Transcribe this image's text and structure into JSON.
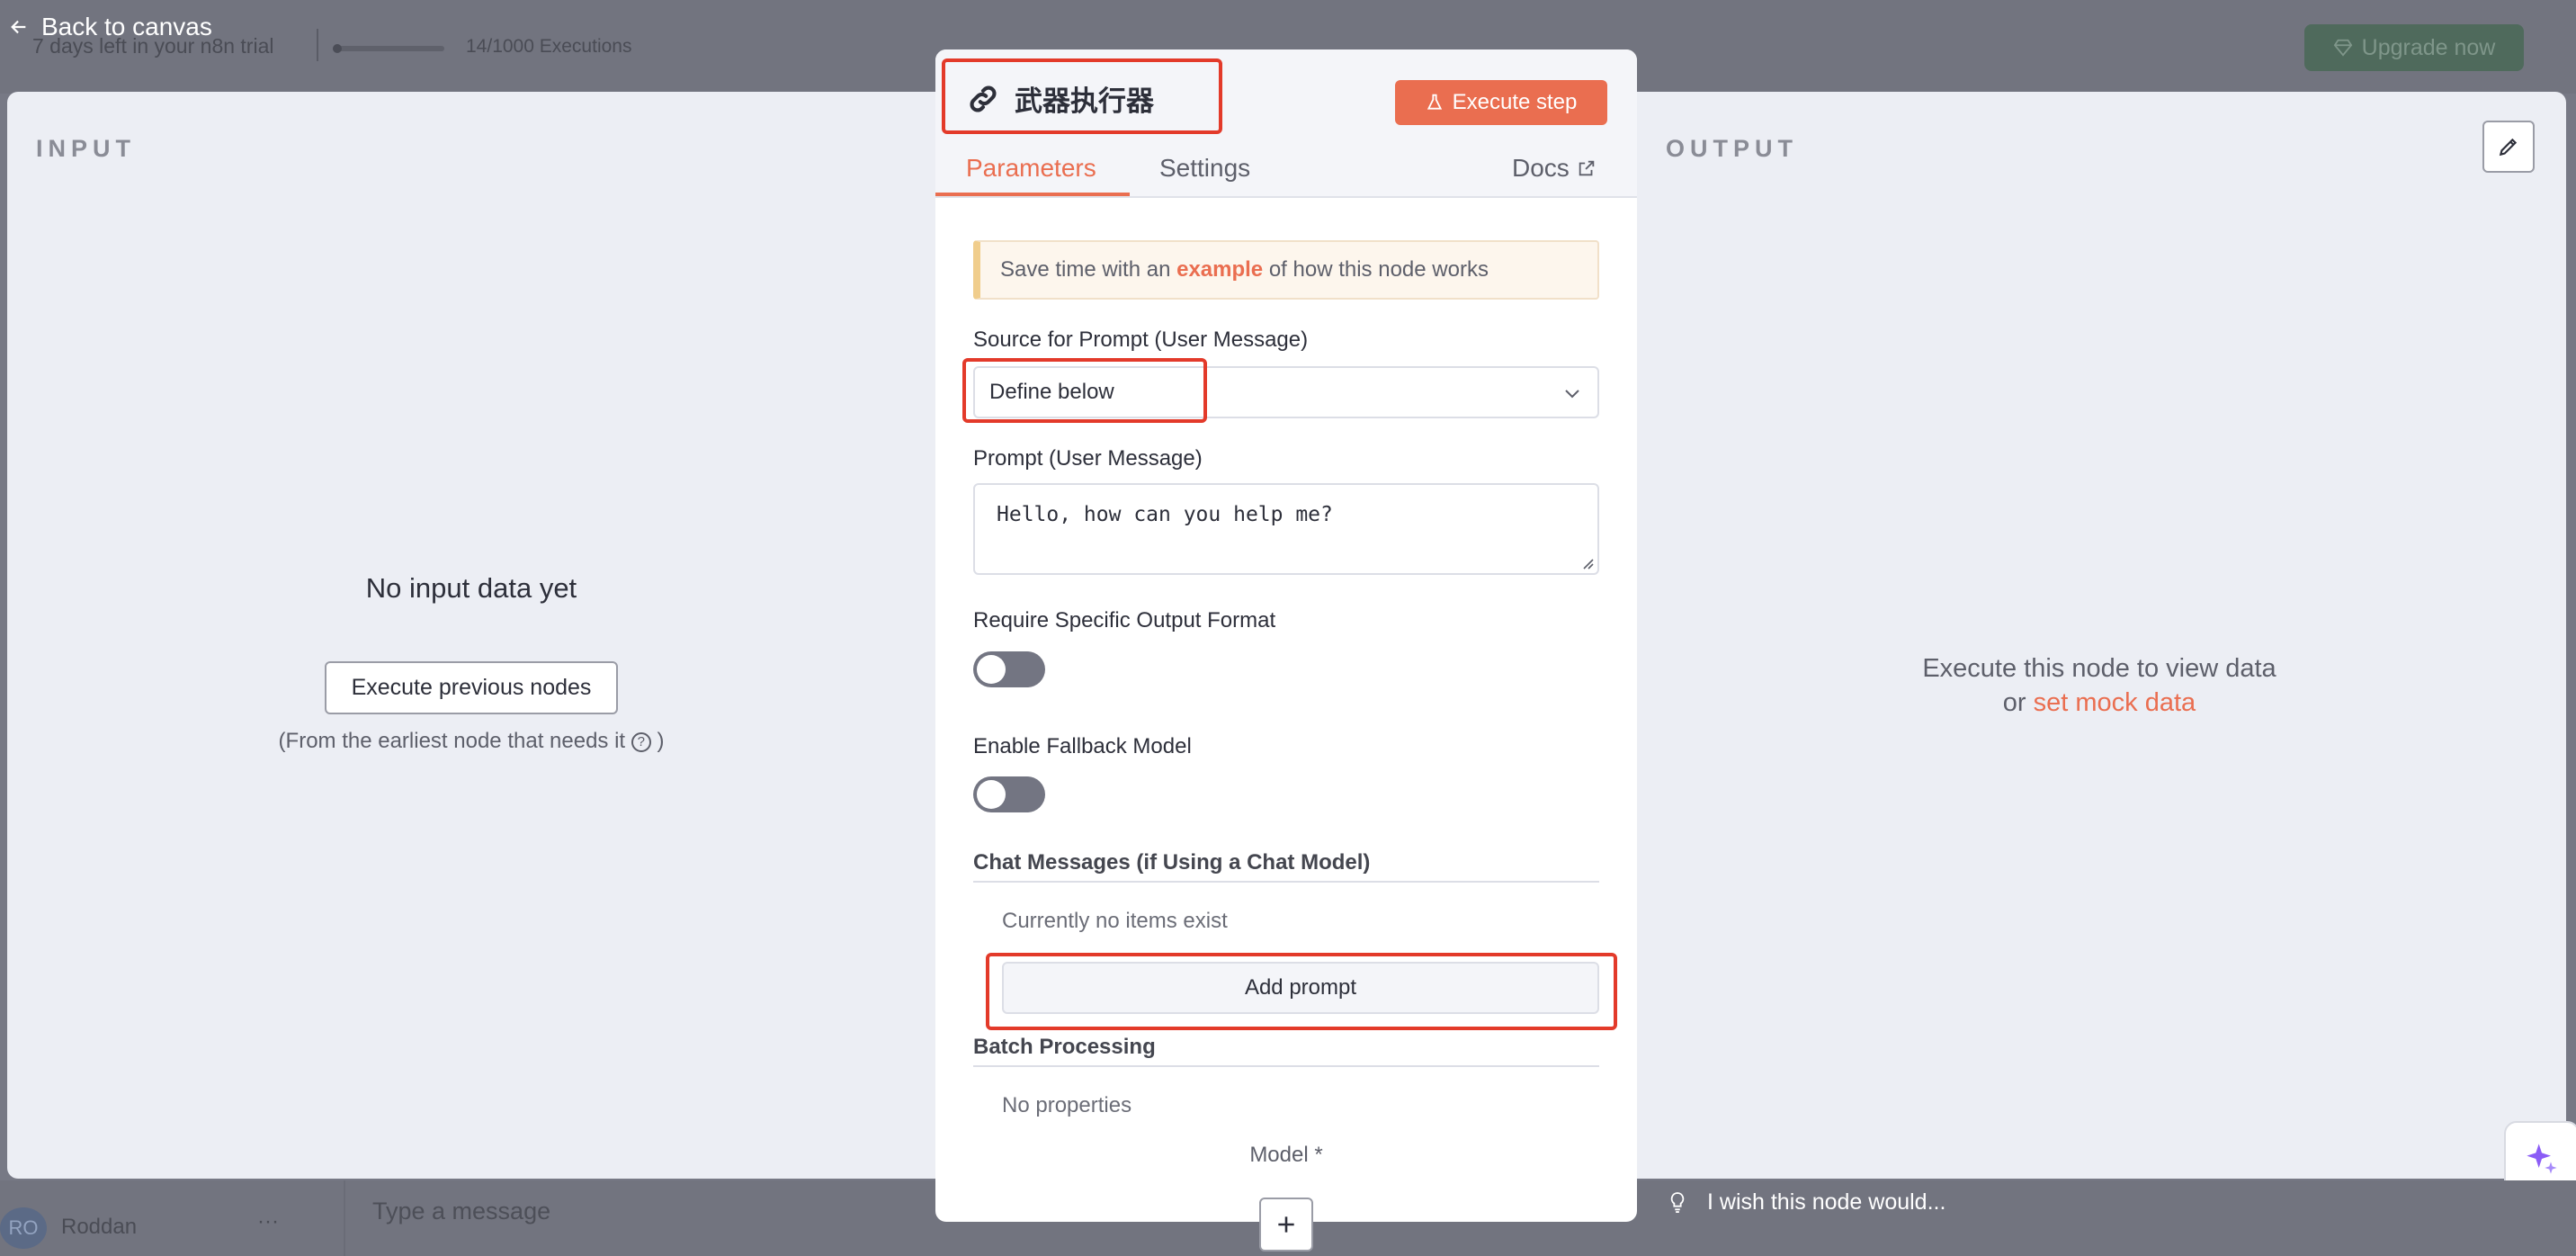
{
  "background": {
    "trial_text": "7 days left in your n8n trial",
    "executions": "14/1000 Executions",
    "trial_progress": 0.014,
    "upgrade_label": "Upgrade now",
    "user_initials": "RO",
    "user_name": "Roddan",
    "user_menu": "···",
    "message_placeholder": "Type a message"
  },
  "back_link": "Back to canvas",
  "input_pane": {
    "title": "INPUT",
    "empty_title": "No input data yet",
    "execute_previous": "Execute previous nodes",
    "earliest_prefix": "(From the earliest node that needs it",
    "earliest_suffix": ")"
  },
  "output_pane": {
    "title": "OUTPUT",
    "execute_hint": "Execute this node to view data",
    "or": "or",
    "mock_link": "set mock data"
  },
  "node": {
    "title": "武器执行器",
    "execute_step": "Execute step",
    "tabs": {
      "parameters": "Parameters",
      "settings": "Settings"
    },
    "docs": "Docs",
    "hint_prefix": "Save time with an",
    "hint_link": "example",
    "hint_suffix": "of how this node works",
    "source_label": "Source for Prompt (User Message)",
    "source_value": "Define below",
    "prompt_label": "Prompt (User Message)",
    "prompt_value": "Hello, how can you help me?",
    "require_format_label": "Require Specific Output Format",
    "fallback_label": "Enable Fallback Model",
    "chat_messages_title": "Chat Messages (if Using a Chat Model)",
    "no_items": "Currently no items exist",
    "add_prompt": "Add prompt",
    "batch_title": "Batch Processing",
    "no_properties": "No properties",
    "model_label": "Model *"
  },
  "wish_text": "I wish this node would...",
  "colors": {
    "accent": "#ea6e50",
    "highlight": "#e33a2a",
    "toggle_off": "#737582"
  },
  "icons": [
    "arrow-left-icon",
    "gem-icon",
    "link-icon",
    "flask-icon",
    "external-link-icon",
    "chevron-down-icon",
    "help-icon",
    "pencil-icon",
    "sparkle-icon",
    "lightbulb-icon",
    "plus-icon",
    "send-icon"
  ]
}
